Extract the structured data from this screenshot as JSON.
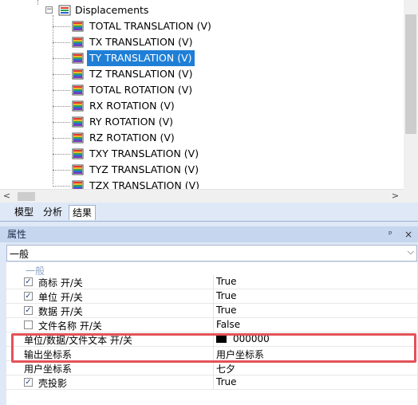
{
  "tree": {
    "parent_label": "Displacements",
    "items": [
      {
        "label": "TOTAL TRANSLATION (V)",
        "selected": false
      },
      {
        "label": "TX TRANSLATION (V)",
        "selected": false
      },
      {
        "label": "TY TRANSLATION (V)",
        "selected": true
      },
      {
        "label": "TZ TRANSLATION (V)",
        "selected": false
      },
      {
        "label": "TOTAL ROTATION (V)",
        "selected": false
      },
      {
        "label": "RX ROTATION (V)",
        "selected": false
      },
      {
        "label": "RY ROTATION (V)",
        "selected": false
      },
      {
        "label": "RZ ROTATION (V)",
        "selected": false
      },
      {
        "label": "TXY TRANSLATION (V)",
        "selected": false
      },
      {
        "label": "TYZ TRANSLATION (V)",
        "selected": false
      },
      {
        "label": "TZX TRANSLATION (V)",
        "selected": false
      }
    ],
    "scroll_left_glyph": "<",
    "scroll_right_glyph": ">"
  },
  "tabs": [
    {
      "label": "模型",
      "active": false
    },
    {
      "label": "分析",
      "active": false
    },
    {
      "label": "结果",
      "active": true
    }
  ],
  "properties": {
    "title": "属性",
    "pin_glyph": "ᵖ",
    "close_glyph": "×",
    "combo_value": "一般",
    "category": "一般",
    "rows": [
      {
        "name": "商标 开/关",
        "value": "True",
        "checkbox": true,
        "checked": true
      },
      {
        "name": "单位 开/关",
        "value": "True",
        "checkbox": true,
        "checked": true
      },
      {
        "name": "数据 开/关",
        "value": "True",
        "checkbox": true,
        "checked": true
      },
      {
        "name": "文件名称 开/关",
        "value": "False",
        "checkbox": true,
        "checked": false
      },
      {
        "name": "单位/数据/文件文本 开/关",
        "value": "000000",
        "checkbox": false,
        "swatch": "#000000"
      },
      {
        "name": "输出坐标系",
        "value": "用户坐标系",
        "checkbox": false
      },
      {
        "name": "用户坐标系",
        "value": "七夕",
        "checkbox": false
      },
      {
        "name": "壳投影",
        "value": "True",
        "checkbox": true,
        "checked": true
      }
    ]
  },
  "colors": {
    "selection": "#1f7fd6",
    "highlight_box": "#e4525a",
    "panel_bg": "#dfe8f6"
  }
}
